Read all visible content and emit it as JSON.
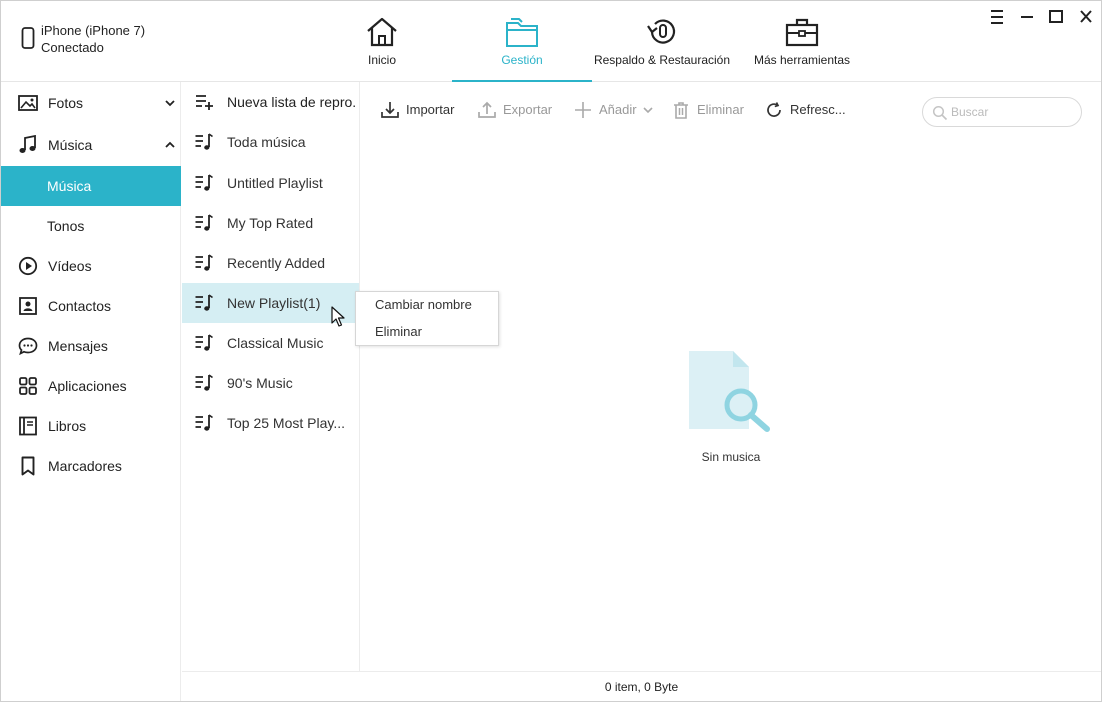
{
  "device": {
    "name": "iPhone (iPhone 7)",
    "status": "Conectado",
    "icon": "phone-icon"
  },
  "nav": {
    "tabs": [
      {
        "label": "Inicio",
        "icon": "home-icon"
      },
      {
        "label": "Gestión",
        "icon": "folder-icon",
        "active": true
      },
      {
        "label": "Respaldo & Restauración",
        "icon": "backup-restore-icon"
      },
      {
        "label": "Más herramientas",
        "icon": "toolbox-icon"
      }
    ]
  },
  "window_controls": [
    "menu-icon",
    "minimize-icon",
    "maximize-icon",
    "close-icon"
  ],
  "sidebar": {
    "items": [
      {
        "label": "Fotos",
        "icon": "photo-icon",
        "chevron": "down"
      },
      {
        "label": "Música",
        "icon": "music-note-icon",
        "chevron": "up"
      },
      {
        "label": "Música",
        "sub": true,
        "selected": true
      },
      {
        "label": "Tonos",
        "sub": true
      },
      {
        "label": "Vídeos",
        "icon": "play-circle-icon"
      },
      {
        "label": "Contactos",
        "icon": "contact-card-icon"
      },
      {
        "label": "Mensajes",
        "icon": "chat-bubble-icon"
      },
      {
        "label": "Aplicaciones",
        "icon": "apps-grid-icon"
      },
      {
        "label": "Libros",
        "icon": "book-icon"
      },
      {
        "label": "Marcadores",
        "icon": "bookmark-icon"
      }
    ]
  },
  "playlists": {
    "new_label": "Nueva lista de repro...",
    "items": [
      "Toda música",
      "Untitled Playlist",
      "My Top Rated",
      "Recently Added",
      "New Playlist(1)",
      "Classical Music",
      "90's Music",
      "Top 25 Most Play..."
    ],
    "hovered_index": 4
  },
  "toolbar": {
    "import_label": "Importar",
    "export_label": "Exportar",
    "add_label": "Añadir",
    "delete_label": "Eliminar",
    "refresh_label": "Refresc..."
  },
  "search": {
    "placeholder": "Buscar",
    "value": ""
  },
  "context_menu": {
    "rename_label": "Cambiar nombre",
    "delete_label": "Eliminar"
  },
  "empty_state": {
    "label": "Sin musica"
  },
  "status_bar": {
    "text": "0 item, 0 Byte"
  },
  "colors": {
    "accent": "#2bb3c9",
    "hover": "#d5eef3",
    "empty_icon": "#dcf0f5",
    "empty_icon_accent": "#8fd4e1"
  }
}
